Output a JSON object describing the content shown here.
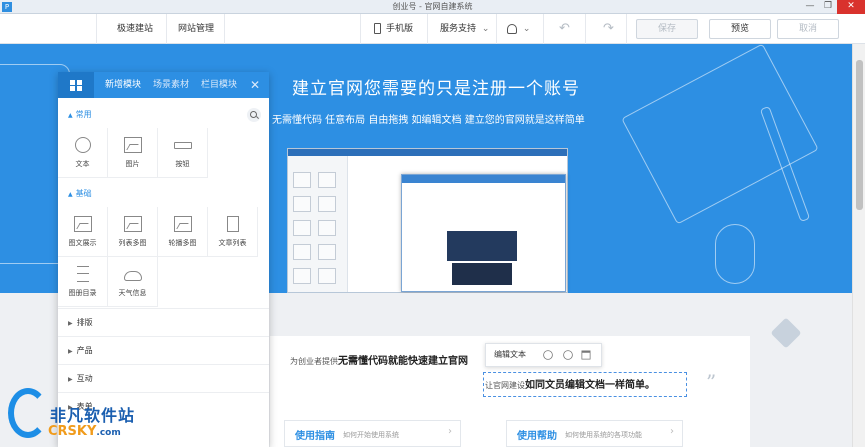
{
  "window": {
    "title": "创业号 - 官网自建系统",
    "app_icon": "P",
    "min_glyph": "—",
    "max_glyph": "❐",
    "close_glyph": "✕"
  },
  "toolbar": {
    "quick_build": "极速建站",
    "site_manage": "网站管理",
    "mobile": "手机版",
    "support": "服务支持",
    "save": "保存",
    "preview": "预览",
    "cancel": "取消",
    "undo_glyph": "↶",
    "redo_glyph": "↷",
    "chevron": "⌄"
  },
  "hero": {
    "title": "建立官网您需要的只是注册一个账号",
    "subtitle": "无需懂代码  任意布局  自由拖拽  如编辑文档  建立您的官网就是这样简单"
  },
  "panel": {
    "tabs": [
      "新增模块",
      "场景素材",
      "栏目模块"
    ],
    "close_glyph": "✕",
    "sections": {
      "common": "常用",
      "basic": "基础"
    },
    "common_items": [
      "文本",
      "图片",
      "按钮"
    ],
    "basic_items": [
      "图文展示",
      "列表多图",
      "轮播多图",
      "文章列表",
      "图册目录",
      "天气信息"
    ],
    "collapsed": [
      "排版",
      "产品",
      "互动",
      "表单"
    ],
    "tri_open": "▲",
    "tri_closed": "▶"
  },
  "content": {
    "intro_prefix": "为创业者提供",
    "intro_bold": "无需懂代码就能快速建立官网",
    "intro2_prefix": "让官网建设",
    "intro2_bold": "如同文员编辑文档一样简单。",
    "quote_glyph": "”",
    "edit_popup_label": "编辑文本"
  },
  "guides": [
    {
      "title": "使用指南",
      "desc": "如何开始使用系统",
      "arrow": "›"
    },
    {
      "title": "使用帮助",
      "desc": "如何使用系统的各项功能",
      "arrow": "›"
    }
  ],
  "watermark": {
    "cn": "非凡软件站",
    "en": "CRSKY",
    "dotcom": ".com"
  },
  "colors": {
    "brand_blue": "#2d8fe3",
    "close_red": "#d9322d"
  },
  "icons": [
    "grid-icon",
    "search-icon",
    "text-icon",
    "image-icon",
    "button-icon",
    "mobile-icon",
    "user-icon",
    "gear-icon",
    "link-icon",
    "trash-icon"
  ]
}
